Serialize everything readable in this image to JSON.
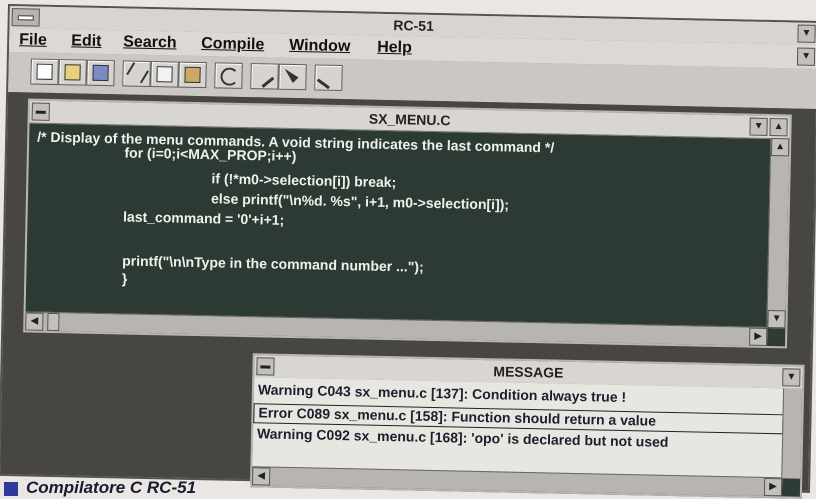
{
  "app": {
    "title": "RC-51",
    "menu": [
      "File",
      "Edit",
      "Search",
      "Compile",
      "Window",
      "Help"
    ]
  },
  "toolbar": {
    "icons": [
      "new-file-icon",
      "open-file-icon",
      "save-icon",
      "cut-icon",
      "copy-icon",
      "paste-icon",
      "undo-icon",
      "compile-icon",
      "build-icon",
      "run-icon"
    ]
  },
  "editor": {
    "title": "SX_MENU.C",
    "lines": [
      "/* Display of the menu commands. A void string indicates the last command */",
      "    for (i=0;i<MAX_PROP;i++)",
      "        if (!*m0->selection[i]) break;",
      "        else printf(\"\\n%d. %s\", i+1, m0->selection[i]);",
      "    last_command = '0'+i+1;",
      "",
      "    printf(\"\\n\\nType in the command number ...\");",
      "    }"
    ]
  },
  "messages": {
    "title": "MESSAGE",
    "items": [
      "Warning C043 sx_menu.c [137]: Condition always true !",
      "Error C089 sx_menu.c [158]: Function should return a value",
      "Warning C092 sx_menu.c [168]: 'opo' is declared but not used"
    ],
    "selected_index": 1
  },
  "caption": {
    "text": "Compilatore C RC-51"
  }
}
